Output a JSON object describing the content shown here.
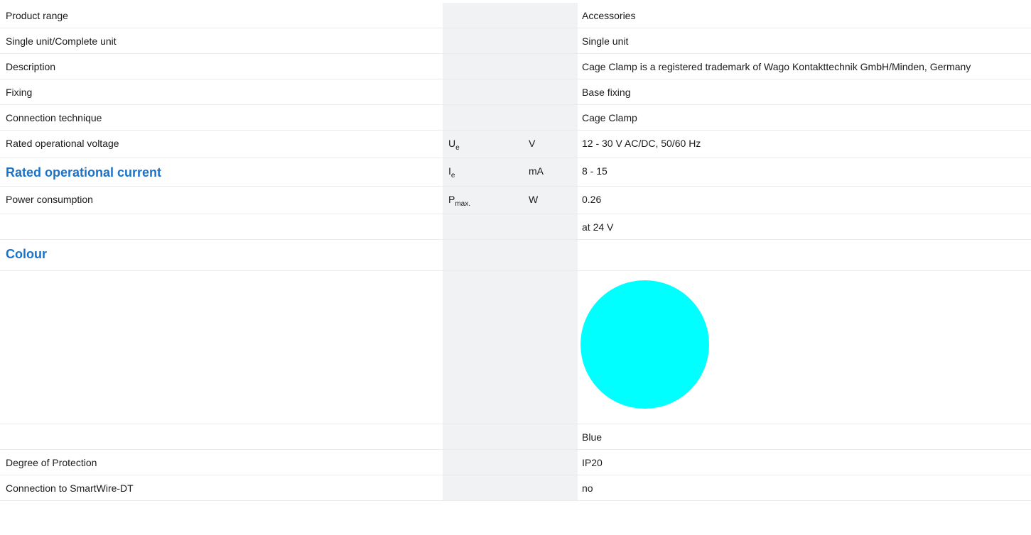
{
  "rows": [
    {
      "label": "Product range",
      "symbol": "",
      "symbol_sub": "",
      "unit": "",
      "value": "Accessories"
    },
    {
      "label": "Single unit/Complete unit",
      "symbol": "",
      "symbol_sub": "",
      "unit": "",
      "value": "Single unit"
    },
    {
      "label": "Description",
      "symbol": "",
      "symbol_sub": "",
      "unit": "",
      "value": "Cage Clamp is a registered trademark of Wago Kontakttechnik GmbH/Minden, Germany"
    },
    {
      "label": "Fixing",
      "symbol": "",
      "symbol_sub": "",
      "unit": "",
      "value": "Base fixing"
    },
    {
      "label": "Connection technique",
      "symbol": "",
      "symbol_sub": "",
      "unit": "",
      "value": "Cage Clamp"
    },
    {
      "label": "Rated operational voltage",
      "symbol": "U",
      "symbol_sub": "e",
      "unit": "V",
      "value": "12 - 30 V AC/DC, 50/60 Hz"
    },
    {
      "label": "Rated operational current",
      "symbol": "I",
      "symbol_sub": "e",
      "unit": "mA",
      "value": "8 - 15"
    },
    {
      "label": "Power consumption",
      "symbol": "P",
      "symbol_sub": "max.",
      "unit": "W",
      "value": "0.26"
    },
    {
      "label": "",
      "symbol": "",
      "symbol_sub": "",
      "unit": "",
      "value": "at 24 V"
    },
    {
      "label": "Colour",
      "symbol": "",
      "symbol_sub": "",
      "unit": "",
      "value": ""
    },
    {
      "label": "",
      "symbol": "",
      "symbol_sub": "",
      "unit": "",
      "value": ""
    },
    {
      "label": "",
      "symbol": "",
      "symbol_sub": "",
      "unit": "",
      "value": "Blue"
    },
    {
      "label": "Degree of Protection",
      "symbol": "",
      "symbol_sub": "",
      "unit": "",
      "value": "IP20"
    },
    {
      "label": "Connection to SmartWire-DT",
      "symbol": "",
      "symbol_sub": "",
      "unit": "",
      "value": "no"
    }
  ],
  "colour_swatch": {
    "color": "#00ffff"
  },
  "colors": {
    "heading": "#1a73c9",
    "shaded_column": "#f1f2f4",
    "row_border": "#ebebeb"
  }
}
